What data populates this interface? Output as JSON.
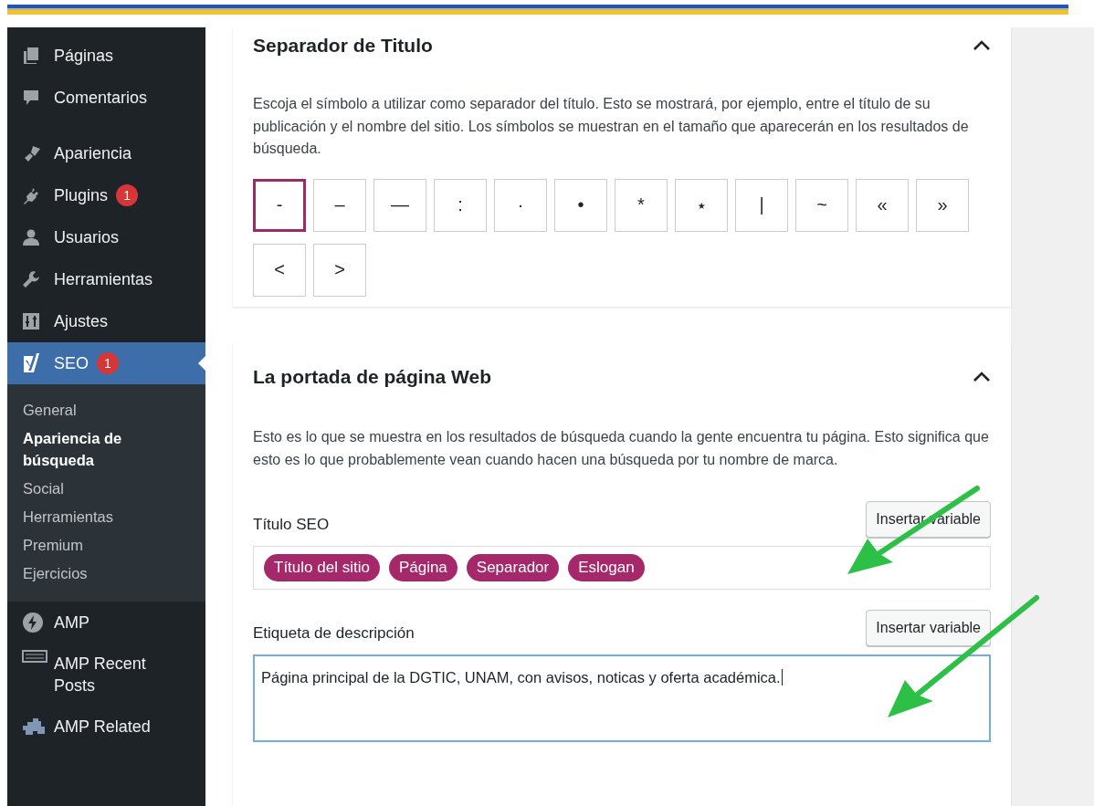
{
  "sidebar": {
    "items": [
      {
        "label": "Páginas",
        "kind": "menu",
        "selected": false
      },
      {
        "label": "Comentarios",
        "kind": "menu",
        "selected": false
      },
      {
        "kind": "gap"
      },
      {
        "label": "Apariencia",
        "kind": "menu",
        "selected": false
      },
      {
        "label": "Plugins",
        "kind": "menu",
        "selected": false,
        "badge": "1"
      },
      {
        "label": "Usuarios",
        "kind": "menu",
        "selected": false
      },
      {
        "label": "Herramientas",
        "kind": "menu",
        "selected": false
      },
      {
        "label": "Ajustes",
        "kind": "menu",
        "selected": false
      },
      {
        "label": "SEO",
        "kind": "menu",
        "selected": true,
        "badge": "1",
        "children": [
          {
            "label": "General",
            "selected": false
          },
          {
            "label": "Apariencia de búsqueda",
            "selected": true
          },
          {
            "label": "Social",
            "selected": false
          },
          {
            "label": "Herramientas",
            "selected": false
          },
          {
            "label": "Premium",
            "selected": false
          },
          {
            "label": "Ejercicios",
            "selected": false
          }
        ]
      },
      {
        "label": "AMP",
        "kind": "menu",
        "selected": false
      },
      {
        "label": "AMP Recent Posts",
        "kind": "menu",
        "selected": false
      },
      {
        "label": "AMP Related",
        "kind": "menu",
        "selected": false
      }
    ]
  },
  "separator_card": {
    "title": "Separador de Titulo",
    "expanded": true,
    "description": "Escoja el símbolo a utilizar como separador del título. Esto se mostrará, por ejemplo, entre el título de su publicación y el nombre del sitio. Los símbolos se muestran en el tamaño que aparecerán en los resultados de búsqueda.",
    "separators": [
      {
        "symbol": "-",
        "selected": true
      },
      {
        "symbol": "–",
        "selected": false
      },
      {
        "symbol": "—",
        "selected": false
      },
      {
        "symbol": ":",
        "selected": false
      },
      {
        "symbol": "·",
        "selected": false
      },
      {
        "symbol": "•",
        "selected": false
      },
      {
        "symbol": "*",
        "selected": false
      },
      {
        "symbol": "⋆",
        "selected": false
      },
      {
        "symbol": "|",
        "selected": false
      },
      {
        "symbol": "~",
        "selected": false
      },
      {
        "symbol": "«",
        "selected": false
      },
      {
        "symbol": "»",
        "selected": false
      },
      {
        "symbol": "<",
        "selected": false
      },
      {
        "symbol": ">",
        "selected": false
      }
    ]
  },
  "homepage_card": {
    "title": "La portada de página Web",
    "expanded": true,
    "description": "Esto es lo que se muestra en los resultados de búsqueda cuando la gente encuentra tu página. Esto significa que esto es lo que probablemente vean cuando hacen una búsqueda por tu nombre de marca.",
    "seo_title": {
      "label": "Título SEO",
      "button": "Insertar variable",
      "chips": [
        "Título del sitio",
        "Página",
        "Separador",
        "Eslogan"
      ]
    },
    "meta_description": {
      "label": "Etiqueta de descripción",
      "button": "Insertar variable",
      "value": "Página principal de la DGTIC, UNAM, con avisos, noticas y oferta académica."
    }
  }
}
